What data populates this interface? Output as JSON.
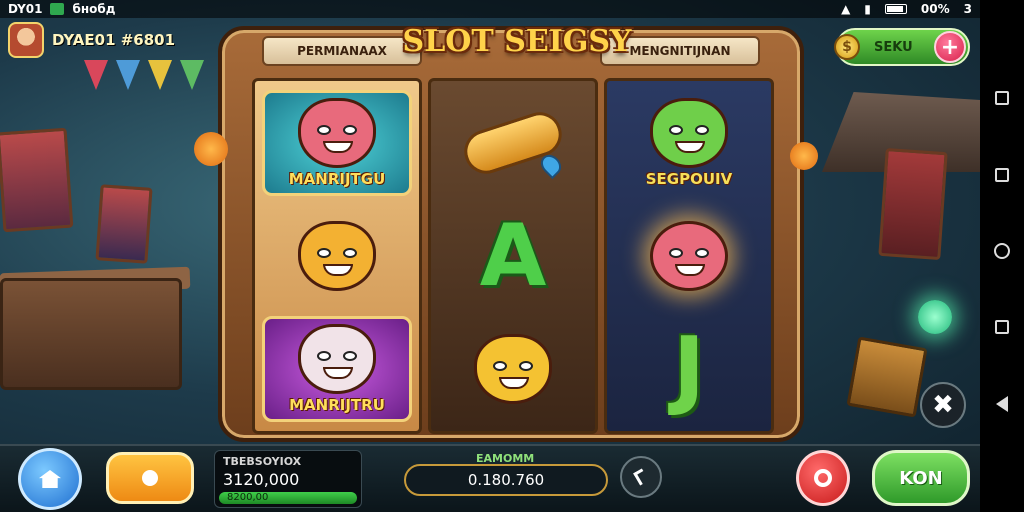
{
  "status_bar": {
    "left_text": "DY01",
    "app_name": "бнобд",
    "battery_text": "00%",
    "right_number": "3"
  },
  "player": {
    "name": "DYAE01 #6801"
  },
  "currency": {
    "label": "SEKU",
    "coin_symbol": "$",
    "plus_label": "+"
  },
  "machine": {
    "title": "SLOT SEIGSY",
    "banner_left": "PERMIANAAX",
    "banner_right": "MENGNITIJNAN"
  },
  "reels": [
    {
      "symbols": [
        {
          "type": "pink-cat",
          "label": "MANRIJTGU",
          "frame": "teal"
        },
        {
          "type": "orange-cat",
          "label": ""
        },
        {
          "type": "white-cat",
          "label": "MANRIJTRU",
          "frame": "purple"
        }
      ]
    },
    {
      "symbols": [
        {
          "type": "gold-scroll",
          "label": ""
        },
        {
          "type": "letter",
          "label": "A"
        },
        {
          "type": "yellow-cat",
          "label": ""
        }
      ]
    },
    {
      "symbols": [
        {
          "type": "green-cat",
          "label": "SEGPOUIV"
        },
        {
          "type": "pink-cat-glow",
          "label": ""
        },
        {
          "type": "letter",
          "label": "J"
        }
      ]
    }
  ],
  "bottom_bar": {
    "balance_label": "TBEBSOYIOX",
    "balance_value": "3120,000",
    "balance_bar_text": "8200,00",
    "win_label": "EAMOMM",
    "win_value": "0.180.760",
    "spin_label": "KON",
    "close_glyph": "✖"
  },
  "icons": {
    "home": "home-icon",
    "bet": "coin-dot-icon",
    "auto": "arrow-icon",
    "target": "target-icon"
  },
  "colors": {
    "spin_green": "#4cc43a",
    "plus_red": "#e0284f",
    "title_gold": "#ffd34a",
    "home_blue": "#1f6fd0"
  }
}
